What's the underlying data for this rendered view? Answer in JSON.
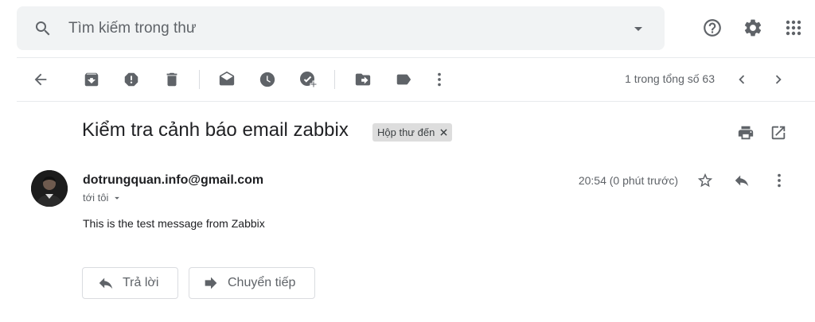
{
  "search": {
    "placeholder": "Tìm kiếm trong thư",
    "icon": "search-icon",
    "options_icon": "caret-down-icon"
  },
  "header_actions": {
    "help_icon": "help-circle-icon",
    "settings_icon": "gear-icon",
    "apps_icon": "apps-grid-icon"
  },
  "toolbar": {
    "icons": [
      "back-arrow-icon",
      "archive-icon",
      "report-spam-icon",
      "delete-icon",
      "mark-unread-icon",
      "snooze-icon",
      "add-to-tasks-icon",
      "move-to-icon",
      "label-icon",
      "more-vert-icon"
    ],
    "pager_text": "1 trong tổng số 63",
    "older_icon": "chevron-left-icon",
    "newer_icon": "chevron-right-icon"
  },
  "message": {
    "subject": "Kiểm tra cảnh báo email zabbix",
    "label": "Hộp thư đến",
    "sender": "dotrungquan.info@gmail.com",
    "to": "tới tôi",
    "time": "20:54 (0 phút trước)",
    "body": "This is the test message from Zabbix"
  },
  "actions": {
    "reply_label": "Trả lời",
    "forward_label": "Chuyển tiếp"
  },
  "colors": {
    "icon_gray": "#5f6368",
    "search_bg": "#f1f3f4",
    "label_bg": "#dddddd",
    "divider": "#e8eaed"
  }
}
